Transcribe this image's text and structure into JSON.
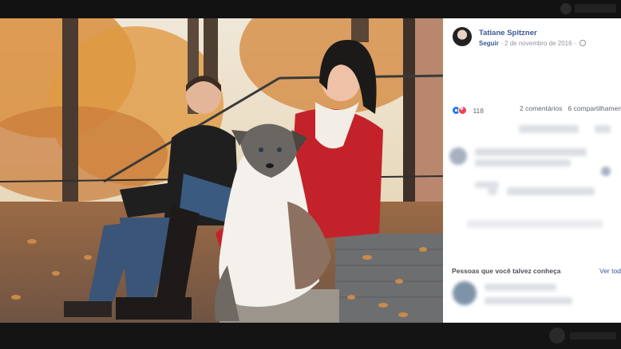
{
  "post": {
    "author": "Tatiane Spitzner",
    "follow": "Seguir",
    "date": "2 de novembro de 2016",
    "reaction_count": "118",
    "comments": "2 comentários",
    "shares": "6 compartilhamen"
  },
  "sidebar": {
    "people_title": "Pessoas que você talvez conheça",
    "see_all": "Ver tod"
  },
  "colors": {
    "link_blue": "#385898",
    "like_blue": "#2078f4",
    "love_red": "#f33e58"
  },
  "icons": [
    "globe-icon",
    "like-reaction-icon",
    "love-reaction-icon"
  ]
}
